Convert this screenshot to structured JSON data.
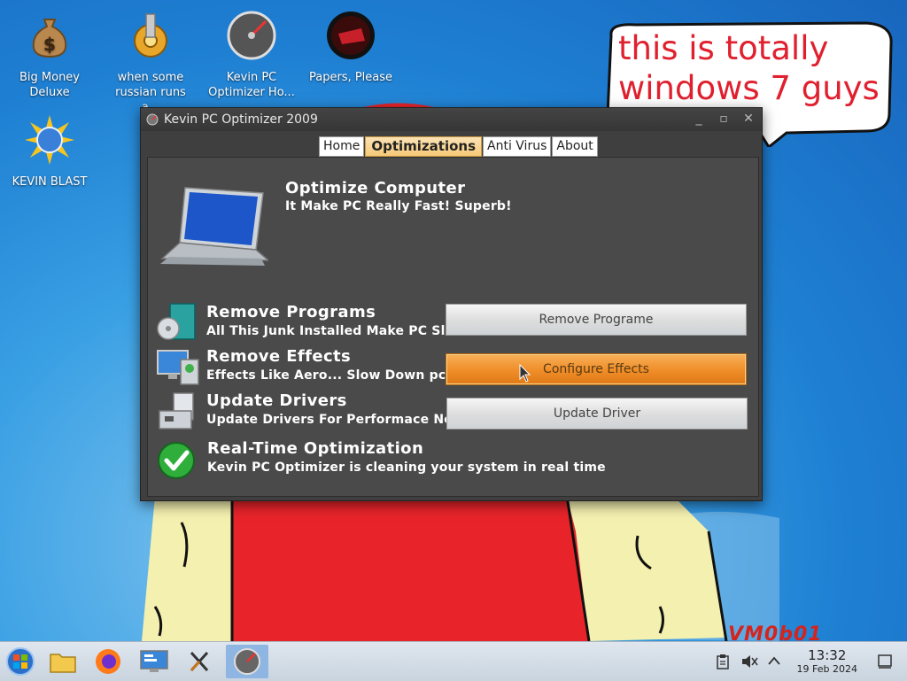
{
  "desktop": {
    "icons": [
      {
        "label_line1": "Big Money",
        "label_line2": "Deluxe",
        "icon": "money-bag-icon"
      },
      {
        "label_line1": "when some",
        "label_line2": "russian runs a...",
        "icon": "gear-icon"
      },
      {
        "label_line1": "Kevin PC",
        "label_line2": "Optimizer Ho...",
        "icon": "speedometer-icon"
      },
      {
        "label_line1": "Papers, Please",
        "label_line2": "",
        "icon": "papers-please-icon"
      },
      {
        "label_line1": "KEVIN BLAST",
        "label_line2": "",
        "icon": "sun-globe-icon"
      }
    ],
    "speech_bubble": {
      "line1": "this is totally",
      "line2": "windows 7 guys"
    },
    "watermark": "VM0b01"
  },
  "window": {
    "title": "Kevin PC Optimizer 2009",
    "controls": {
      "minimize": "_",
      "maximize": "▫",
      "close": "✕"
    },
    "tabs": [
      {
        "label": "Home",
        "active": false
      },
      {
        "label": "Optimizations",
        "active": true
      },
      {
        "label": "Anti Virus",
        "active": false
      },
      {
        "label": "About",
        "active": false
      }
    ],
    "header": {
      "title": "Optimize Computer",
      "subtitle": "It Make PC Really Fast! Superb!"
    },
    "rows": [
      {
        "title": "Remove Programs",
        "desc": "All This Junk Installed Make PC Slow.",
        "button": "Remove Programe",
        "icon": "software-box-icon"
      },
      {
        "title": "Remove Effects",
        "desc": "Effects Like Aero... Slow Down pc.",
        "button": "Configure Effects",
        "icon": "display-settings-icon"
      },
      {
        "title": "Update Drivers",
        "desc": "Update Drivers For Performace Now!",
        "button": "Update Driver",
        "icon": "hardware-icon"
      }
    ],
    "realtime": {
      "title": "Real-Time Optimization",
      "desc": "Kevin PC Optimizer is cleaning your system in real time",
      "icon": "checkmark-icon"
    }
  },
  "taskbar": {
    "items": [
      "start-orb-icon",
      "file-explorer-icon",
      "firefox-icon",
      "control-panel-icon",
      "x-app-icon",
      "kevin-optimizer-icon"
    ],
    "active_item": "kevin-optimizer-icon",
    "clock": {
      "time": "13:32",
      "date": "19 Feb 2024"
    }
  },
  "colors": {
    "accent_orange": "#ef8d28",
    "speech_red": "#e0202e",
    "shirt_red": "#e8242a"
  }
}
